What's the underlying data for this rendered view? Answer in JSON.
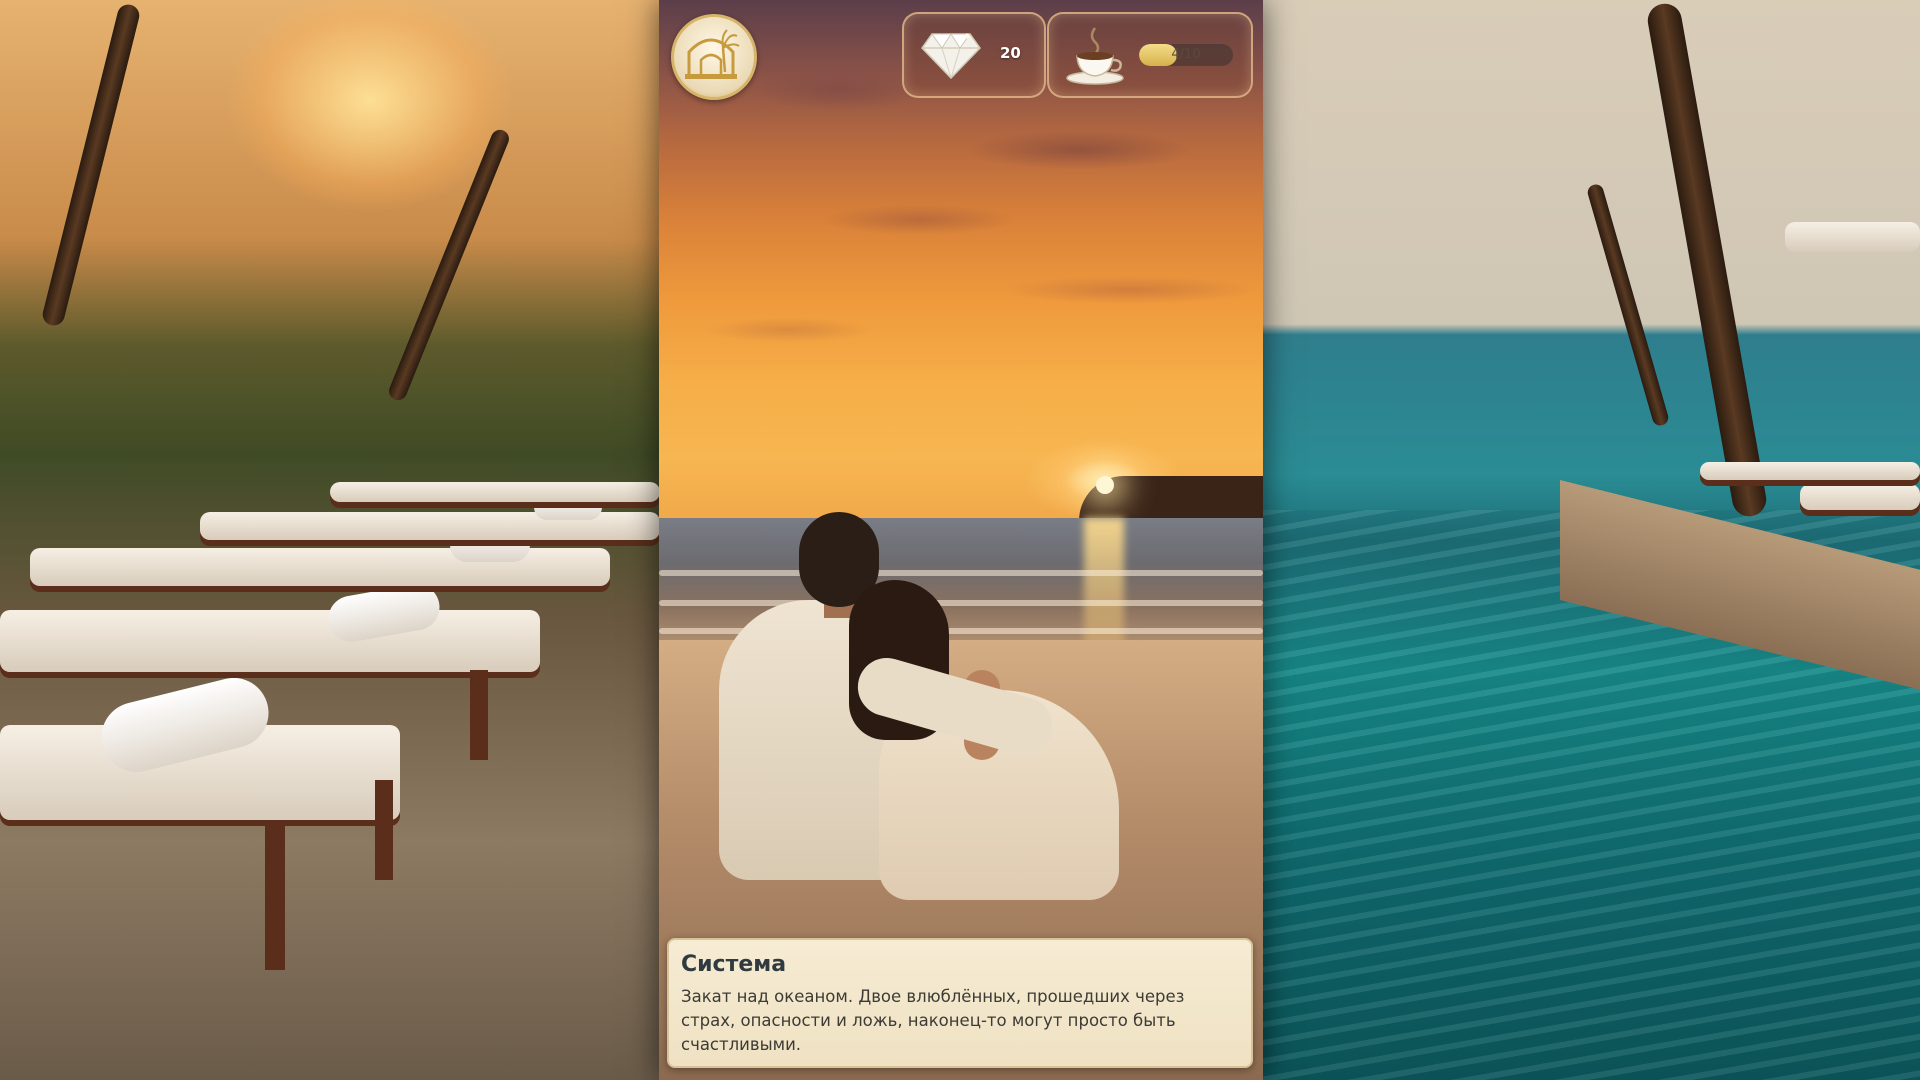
{
  "hud": {
    "gems": {
      "icon": "diamond-icon",
      "count": "20"
    },
    "energy": {
      "icon": "coffee-cup-icon",
      "current": 4,
      "max": 10,
      "label": "4/10"
    },
    "logo": {
      "icon": "palace-logo-icon"
    }
  },
  "dialogue": {
    "speaker": "Система",
    "text": "Закат над океаном. Двое влюблённых, прошедших через страх, опасности и ложь, наконец-то могут просто быть счастливыми."
  },
  "colors": {
    "accent_gold": "#d6b46a",
    "dialog_bg": "#f6ecd4",
    "speaker_text": "#2f3b3f"
  }
}
